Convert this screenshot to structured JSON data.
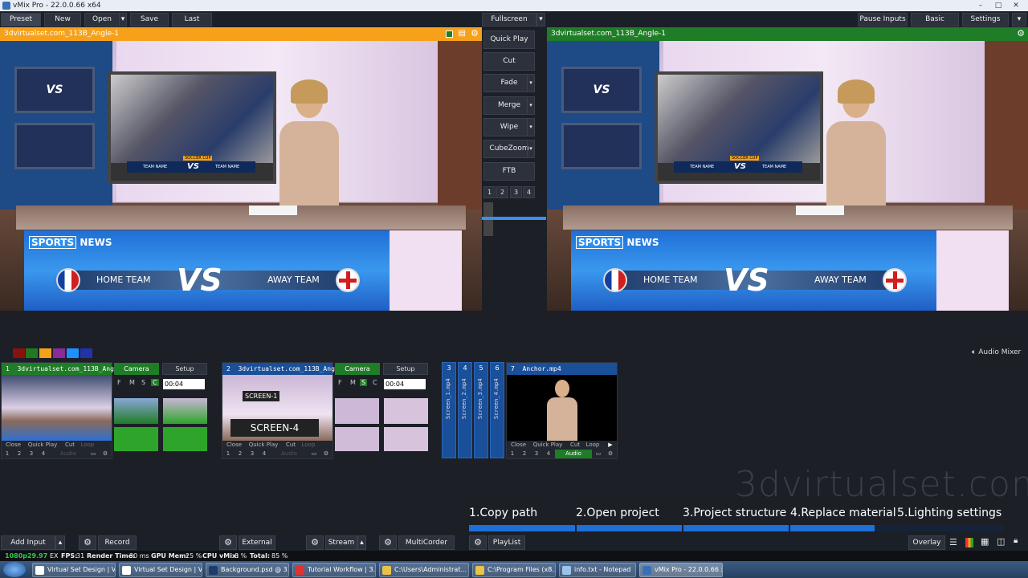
{
  "window": {
    "title": "vMix Pro - 22.0.0.66 x64",
    "min": "–",
    "max": "□",
    "close": "✕"
  },
  "menu": {
    "preset": "Preset",
    "new": "New",
    "open": "Open",
    "save": "Save",
    "last": "Last",
    "fullscreen": "Fullscreen",
    "pause_inputs": "Pause Inputs",
    "basic": "Basic",
    "settings": "Settings"
  },
  "preview": {
    "title": "3dvirtualset.com_113B_Angle-1",
    "accent": "#f7a11a"
  },
  "output": {
    "title": "3dvirtualset.com_113B_Angle-1",
    "accent": "#1e7d26"
  },
  "scene": {
    "brand_left": "SPORTS",
    "brand_right": "NEWS",
    "home": "HOME TEAM",
    "vs": "VS",
    "away": "AWAY TEAM",
    "screen_team": "TEAM NAME",
    "screen_team2": "TEAM NAME",
    "screen_cup": "SOCCER CUP"
  },
  "transitions": {
    "quick_play": "Quick Play",
    "cut": "Cut",
    "fade": "Fade",
    "merge": "Merge",
    "wipe": "Wipe",
    "cubezoom": "CubeZoom",
    "ftb": "FTB",
    "nums": [
      "1",
      "2",
      "3",
      "4"
    ]
  },
  "audio_mixer": "Audio Mixer",
  "swatches": [
    "#8b1010",
    "#1f7a1f",
    "#f7a11a",
    "#8b2a9a",
    "#1e90ff",
    "#2233aa"
  ],
  "inputs": [
    {
      "num": "1",
      "name": "3dvirtualset.com_113B_Angle-1",
      "camera": "Camera",
      "setup": "Setup",
      "flags": [
        "F",
        "M",
        "S",
        "C"
      ],
      "time": "00:04",
      "actions": [
        "Close",
        "Quick Play",
        "Cut",
        "Loop"
      ],
      "nums": [
        "1",
        "2",
        "3",
        "4"
      ],
      "audio": "Audio"
    },
    {
      "num": "2",
      "name": "3dvirtualset.com_113B_Angle-2",
      "camera": "Camera",
      "setup": "Setup",
      "flags": [
        "F",
        "M",
        "S",
        "C"
      ],
      "time": "00:04",
      "actions": [
        "Close",
        "Quick Play",
        "Cut",
        "Loop"
      ],
      "nums": [
        "1",
        "2",
        "3",
        "4"
      ],
      "audio": "Audio",
      "screen1": "SCREEN-1",
      "screen4": "SCREEN-4"
    },
    {
      "num": "7",
      "name": "Anchor.mp4",
      "actions": [
        "Close",
        "Quick Play",
        "Cut",
        "Loop"
      ],
      "nums": [
        "1",
        "2",
        "3",
        "4"
      ],
      "audio": "Audio"
    }
  ],
  "vtabs": [
    {
      "num": "3",
      "label": "Screen_1.mp4"
    },
    {
      "num": "4",
      "label": "Screen_2.mp4"
    },
    {
      "num": "5",
      "label": "Screen_3.mp4"
    },
    {
      "num": "6",
      "label": "Screen_4.mp4"
    }
  ],
  "watermark": "3dvirtualset.com",
  "steps": [
    "1.Copy path",
    "2.Open project",
    "3.Project structure",
    "4.Replace material",
    "5.Lighting settings"
  ],
  "progress": {
    "done_segments": 3,
    "partial_fraction": 0.8
  },
  "bottom": {
    "add_input": "Add Input",
    "record": "Record",
    "external": "External",
    "stream": "Stream",
    "multicorder": "MultiCorder",
    "playlist": "PlayList",
    "overlay": "Overlay"
  },
  "status": {
    "format": "1080p29.97",
    "ex": "EX",
    "fps_label": "FPS:",
    "fps": "31",
    "render_label": "Render Time:",
    "render": "30 ms",
    "gpu_label": "GPU Mem:",
    "gpu": "25 %",
    "cpu_label": "CPU vMix:",
    "cpu": "8 %",
    "total_label": "Total:",
    "total": "85 %"
  },
  "taskbar": [
    "Virtual Set Design | Vi...",
    "Virtual Set Design | Vi...",
    "Background.psd @ 3...",
    "Tutorial Workflow | 3...",
    "C:\\Users\\Administrat...",
    "C:\\Program Files (x8...",
    "info.txt - Notepad",
    "vMix Pro - 22.0.0.66 x..."
  ]
}
